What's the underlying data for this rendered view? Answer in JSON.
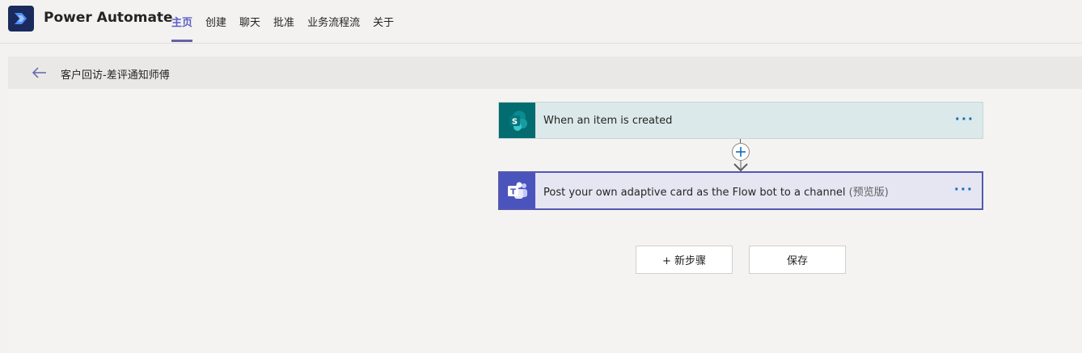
{
  "app": {
    "title": "Power Automate",
    "logo_icon": "power-automate-logo",
    "nav": [
      {
        "label": "主页",
        "active": true
      },
      {
        "label": "创建",
        "active": false
      },
      {
        "label": "聊天",
        "active": false
      },
      {
        "label": "批准",
        "active": false
      },
      {
        "label": "业务流程流",
        "active": false
      },
      {
        "label": "关于",
        "active": false
      }
    ]
  },
  "subheader": {
    "back_icon": "arrow-left-icon",
    "flow_name": "客户回访-差评通知师傅"
  },
  "steps": [
    {
      "label": "When an item is created",
      "suffix": "",
      "connector_icon": "sharepoint-icon",
      "more_label": "···",
      "color": "#036c70"
    },
    {
      "label": "Post your own adaptive card as the Flow bot to a channel",
      "suffix": " (预览版)",
      "connector_icon": "teams-icon",
      "more_label": "···",
      "color": "#4b53bc",
      "selected": true
    }
  ],
  "actions": {
    "new_step_label": "+ 新步骤",
    "save_label": "保存"
  },
  "colors": {
    "accent": "#6264a7",
    "sharepoint": "#036c70",
    "teams": "#4b53bc",
    "link": "#0f6cbd"
  }
}
